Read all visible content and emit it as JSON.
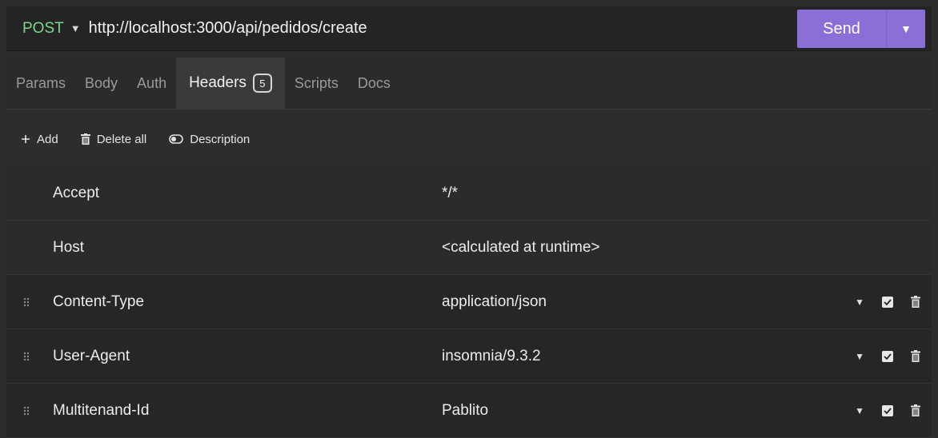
{
  "request": {
    "method": "POST",
    "url": "http://localhost:3000/api/pedidos/create",
    "send_label": "Send"
  },
  "tabs": [
    {
      "label": "Params"
    },
    {
      "label": "Body"
    },
    {
      "label": "Auth"
    },
    {
      "label": "Headers",
      "badge": "5",
      "active": true
    },
    {
      "label": "Scripts"
    },
    {
      "label": "Docs"
    }
  ],
  "toolbar": {
    "add_label": "Add",
    "delete_all_label": "Delete all",
    "description_label": "Description"
  },
  "headers": {
    "static": [
      {
        "name": "Accept",
        "value": "*/*"
      },
      {
        "name": "Host",
        "value": "<calculated at runtime>"
      }
    ],
    "custom": [
      {
        "name": "Content-Type",
        "value": "application/json",
        "enabled": true
      },
      {
        "name": "User-Agent",
        "value": "insomnia/9.3.2",
        "enabled": true
      },
      {
        "name": "Multitenand-Id",
        "value": "Pablito",
        "enabled": true
      }
    ]
  },
  "colors": {
    "method": "#7bd88f",
    "send": "#8b6fd6",
    "background": "#2d2d2d"
  }
}
